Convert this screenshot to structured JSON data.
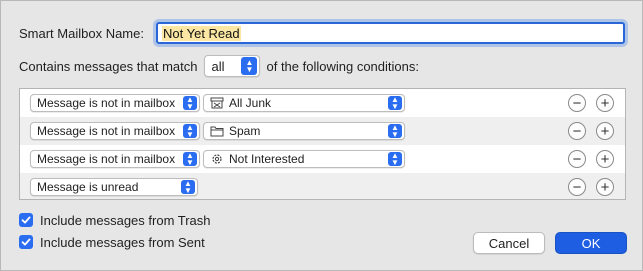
{
  "dialog": {
    "name_label": "Smart Mailbox Name:",
    "name_value": "Not Yet Read",
    "match_prefix": "Contains messages that match",
    "match_value": "all",
    "match_suffix": "of the following conditions:"
  },
  "rules": [
    {
      "field": "Message is not in mailbox",
      "value": "All Junk",
      "icon": "junk-mailbox-icon"
    },
    {
      "field": "Message is not in mailbox",
      "value": "Spam",
      "icon": "folder-icon"
    },
    {
      "field": "Message is not in mailbox",
      "value": "Not Interested",
      "icon": "gear-icon"
    },
    {
      "field": "Message is unread"
    }
  ],
  "options": {
    "include_trash": "Include messages from Trash",
    "include_trash_checked": true,
    "include_sent": "Include messages from Sent",
    "include_sent_checked": true
  },
  "buttons": {
    "cancel": "Cancel",
    "ok": "OK"
  },
  "colors": {
    "accent": "#2a6df0",
    "ok_button": "#1d5ee3",
    "selection": "#fbe7a3"
  }
}
